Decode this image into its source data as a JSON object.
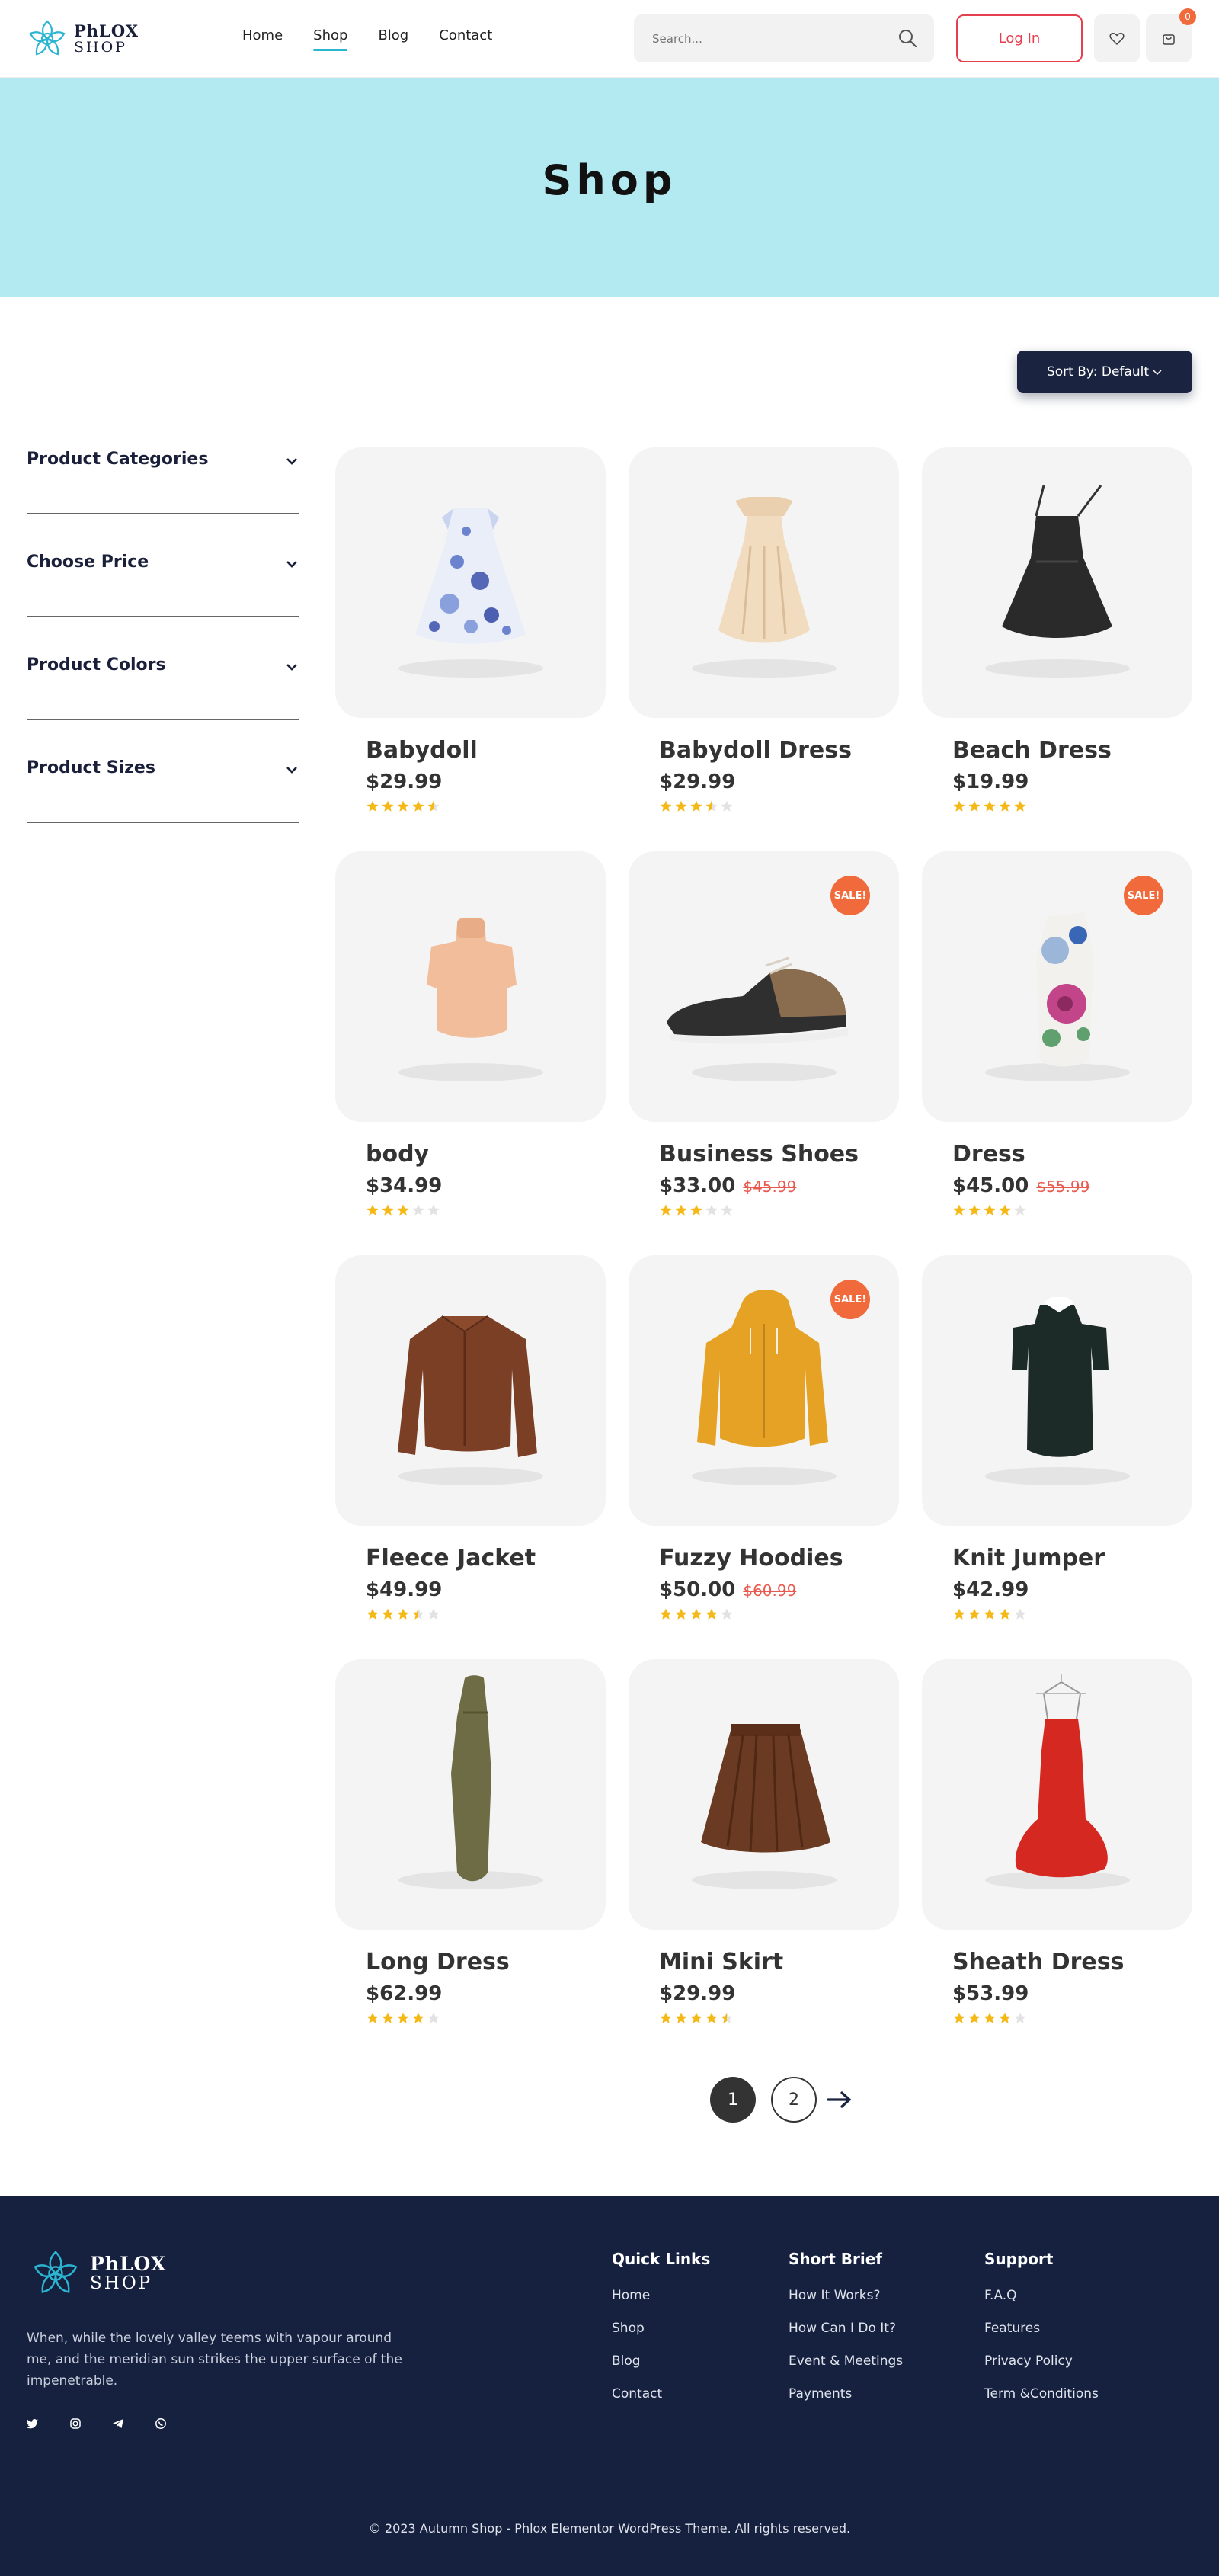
{
  "header": {
    "logo_line1": "PhLOX",
    "logo_line2": "SHOP",
    "nav": [
      "Home",
      "Shop",
      "Blog",
      "Contact"
    ],
    "active_nav": "Shop",
    "search_placeholder": "Search...",
    "login_label": "Log In",
    "cart_count": "0",
    "accent_color": "#2bb5d1"
  },
  "banner": {
    "title": "Shop",
    "background": "#b3eaf2"
  },
  "sort": {
    "label": "Sort By: Default"
  },
  "filters": [
    "Product Categories",
    "Choose Price",
    "Product Colors",
    "Product Sizes"
  ],
  "products": [
    {
      "name": "Babydoll",
      "price": "$29.99",
      "old_price": "",
      "sale": false,
      "rating": 4.5,
      "icon": "dress-icon"
    },
    {
      "name": "Babydoll Dress",
      "price": "$29.99",
      "old_price": "",
      "sale": false,
      "rating": 3.5,
      "icon": "gown-icon"
    },
    {
      "name": "Beach Dress",
      "price": "$19.99",
      "old_price": "",
      "sale": false,
      "rating": 5,
      "icon": "slip-dress-icon"
    },
    {
      "name": "body",
      "price": "$34.99",
      "old_price": "",
      "sale": false,
      "rating": 3,
      "icon": "turtleneck-icon"
    },
    {
      "name": "Business Shoes",
      "price": "$33.00",
      "old_price": "$45.99",
      "sale": true,
      "rating": 3,
      "icon": "shoe-icon"
    },
    {
      "name": "Dress",
      "price": "$45.00",
      "old_price": "$55.99",
      "sale": true,
      "rating": 4,
      "icon": "floral-dress-icon"
    },
    {
      "name": "Fleece Jacket",
      "price": "$49.99",
      "old_price": "",
      "sale": false,
      "rating": 3.5,
      "icon": "jacket-icon"
    },
    {
      "name": "Fuzzy Hoodies",
      "price": "$50.00",
      "old_price": "$60.99",
      "sale": true,
      "rating": 4,
      "icon": "hoodie-icon"
    },
    {
      "name": "Knit Jumper",
      "price": "$42.99",
      "old_price": "",
      "sale": false,
      "rating": 4,
      "icon": "knit-dress-icon"
    },
    {
      "name": "Long Dress",
      "price": "$62.99",
      "old_price": "",
      "sale": false,
      "rating": 4,
      "icon": "long-dress-icon"
    },
    {
      "name": "Mini Skirt",
      "price": "$29.99",
      "old_price": "",
      "sale": false,
      "rating": 4.5,
      "icon": "skirt-icon"
    },
    {
      "name": "Sheath Dress",
      "price": "$53.99",
      "old_price": "",
      "sale": false,
      "rating": 4,
      "icon": "red-dress-icon"
    }
  ],
  "sale_label": "SALE!",
  "pagination": {
    "pages": [
      "1",
      "2"
    ],
    "current": "1"
  },
  "footer": {
    "logo_line1": "PhLOX",
    "logo_line2": "SHOP",
    "about": "When, while the lovely valley teems with vapour around me, and the meridian sun strikes the upper surface of the impenetrable.",
    "social": [
      "twitter-icon",
      "instagram-icon",
      "telegram-icon",
      "whatsapp-icon"
    ],
    "columns": [
      {
        "title": "Quick Links",
        "links": [
          "Home",
          "Shop",
          "Blog",
          "Contact"
        ]
      },
      {
        "title": "Short Brief",
        "links": [
          "How It Works?",
          "How Can I Do It?",
          "Event & Meetings",
          "Payments"
        ]
      },
      {
        "title": "Support",
        "links": [
          "F.A.Q",
          "Features",
          "Privacy Policy",
          "Term &Conditions"
        ]
      }
    ],
    "copyright": "© 2023 Autumn Shop - Phlox Elementor WordPress Theme. All rights reserved.",
    "background": "#15213f"
  }
}
